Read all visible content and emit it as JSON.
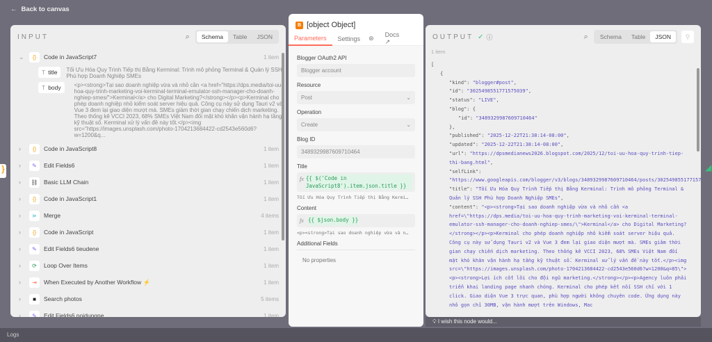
{
  "back_label": "Back to canvas",
  "input": {
    "title": "INPUT",
    "views": [
      "Schema",
      "Table",
      "JSON"
    ],
    "active_view": "Schema",
    "expanded": {
      "name": "Code in JavaScript7",
      "count": "1 item",
      "fields": [
        {
          "key": "title",
          "value": "Tối Ưu Hóa Quy Trình Tiếp thị Bằng Kerminal: Trình mô phỏng Terminal & Quản lý SSH Phù hợp Doanh Nghiệp SMEs"
        },
        {
          "key": "body",
          "value": "<p><strong>Tại sao doanh nghiệp vừa và nhỏ cần <a href=\"https://dps.media/toi-uu-hoa-quy-trinh-marketing-voi-kerminal-terminal-emulator-ssh-manager-cho-doanh-nghiep-smes/\">Kerminal</a> cho Digital Marketing?</strong></p><p>Kerminal cho phép doanh nghiệp nhỏ kiểm soát server hiệu quả. Công cụ này sử dụng Tauri v2 và Vue 3 đem lại giao diện mượt mà. SMEs giảm thời gian chạy chiến dịch marketing. Theo thống kê VCCI 2023, 68% SMEs Việt Nam đối mặt khó khăn vận hành hạ tầng kỹ thuật số. Kerminal xử lý vấn đề này tốt.</p><img src=\"https://images.unsplash.com/photo-1704213684422-cd2543e560d6?w=1200&q..."
        }
      ]
    },
    "nodes": [
      {
        "name": "Code in JavaScript8",
        "count": "1 item",
        "icon": "code-icon",
        "glyph": "{}",
        "color": "#f5a623"
      },
      {
        "name": "Edit Fields6",
        "count": "1 item",
        "icon": "pencil-icon",
        "glyph": "✎",
        "color": "#7b6cf6"
      },
      {
        "name": "Basic LLM Chain",
        "count": "1 item",
        "icon": "link-icon",
        "glyph": "⛓",
        "color": "#555"
      },
      {
        "name": "Code in JavaScript1",
        "count": "1 item",
        "icon": "code-icon",
        "glyph": "{}",
        "color": "#f5a623"
      },
      {
        "name": "Merge",
        "count": "4 items",
        "icon": "merge-icon",
        "glyph": "⋗",
        "color": "#3bb3c3"
      },
      {
        "name": "Code in JavaScript",
        "count": "1 item",
        "icon": "code-icon",
        "glyph": "{}",
        "color": "#f5a623"
      },
      {
        "name": "Edit Fields6 tieudene",
        "count": "1 item",
        "icon": "pencil-icon",
        "glyph": "✎",
        "color": "#7b6cf6"
      },
      {
        "name": "Loop Over Items",
        "count": "1 item",
        "icon": "loop-icon",
        "glyph": "⟳",
        "color": "#2c9a5a"
      },
      {
        "name": "When Executed by Another Workflow",
        "count": "1 item",
        "icon": "trigger-icon",
        "glyph": "⇥",
        "color": "#ff6d5a",
        "badge": "⚡"
      },
      {
        "name": "Search photos",
        "count": "5 items",
        "icon": "camera-icon",
        "glyph": "■",
        "color": "#222"
      },
      {
        "name": "Edit Fields6 noidungne",
        "count": "1 item",
        "icon": "pencil-icon",
        "glyph": "✎",
        "color": "#7b6cf6"
      }
    ]
  },
  "node": {
    "title": {
      "label": "Title",
      "expr": "{{ $('Code in JavaScript8').item.json.title }}",
      "preview": "Tối Ưu Hóa Quy Trình Tiếp thị Bằng Kermi…"
    },
    "logo": "B",
    "tabs": {
      "parameters": "Parameters",
      "settings": "Settings",
      "docs": "Docs"
    },
    "credential": {
      "label": "Blogger OAuth2 API",
      "value": "Blogger account"
    },
    "resource": {
      "label": "Resource",
      "value": "Post"
    },
    "operation": {
      "label": "Operation",
      "value": "Create"
    },
    "blog_id": {
      "label": "Blog ID",
      "value": "3489329987609710464"
    },
    "content": {
      "label": "Content",
      "expr": "{{ $json.body }}",
      "preview": "<p><strong>Tại sao doanh nghiệp vừa và n…"
    },
    "additional": {
      "label": "Additional Fields",
      "empty": "No properties"
    }
  },
  "output": {
    "title": "OUTPUT",
    "views": [
      "Schema",
      "Table",
      "JSON"
    ],
    "active_view": "JSON",
    "count": "1 item",
    "lines": [
      {
        "i": 0,
        "t": "["
      },
      {
        "i": 1,
        "t": "{"
      },
      {
        "i": 2,
        "k": "\"kind\": ",
        "v": "\"blogger#post\"",
        "e": ","
      },
      {
        "i": 2,
        "k": "\"id\": ",
        "v": "\"3025498551771575039\"",
        "e": ","
      },
      {
        "i": 2,
        "k": "\"status\": ",
        "v": "\"LIVE\"",
        "e": ","
      },
      {
        "i": 2,
        "k": "\"blog\": ",
        "t": "{"
      },
      {
        "i": 3,
        "k": "\"id\": ",
        "v": "\"3489329987609710464\""
      },
      {
        "i": 2,
        "t": "},"
      },
      {
        "i": 2,
        "k": "\"published\": ",
        "v": "\"2025-12-22T21:38:14-08:00\"",
        "e": ","
      },
      {
        "i": 2,
        "k": "\"updated\": ",
        "v": "\"2025-12-22T21:38:14-08:00\"",
        "e": ","
      },
      {
        "i": 2,
        "k": "\"url\": ",
        "v": "\"https://dpsmedianews2026.blogspot.com/2025/12/toi-uu-hoa-quy-trinh-tiep-thi-bang.html\"",
        "e": ","
      },
      {
        "i": 2,
        "k": "\"selfLink\": ",
        "v": "\"https://www.googleapis.com/blogger/v3/blogs/3489329987609710464/posts/3025498551771575039\"",
        "e": ","
      },
      {
        "i": 2,
        "k": "\"title\": ",
        "v": "\"Tối Ưu Hóa Quy Trình Tiếp thị Bằng Kerminal: Trình mô phỏng Terminal & Quản lý SSH Phù hợp Doanh Nghiệp SMEs\"",
        "e": ","
      },
      {
        "i": 2,
        "k": "\"content\": ",
        "v": "\"<p><strong>Tại sao doanh nghiệp vừa và nhỏ cần <a href=\\\"https://dps.media/toi-uu-hoa-quy-trinh-marketing-voi-kerminal-terminal-emulator-ssh-manager-cho-doanh-nghiep-smes/\\\">Kerminal</a> cho Digital Marketing?</strong></p><p>Kerminal cho phép doanh nghiệp nhỏ kiểm soát server hiệu quả. Công cụ này sử dụng Tauri v2 và Vue 3 đem lại giao diện mượt mà. SMEs giảm thời gian chạy chiến dịch marketing. Theo thống kê VCCI 2023, 68% SMEs Việt Nam đối mặt khó khăn vận hành hạ tầng kỹ thuật số. Kerminal xử lý vấn đề này tốt.</p><img src=\\\"https://images.unsplash.com/photo-1704213684422-cd2543e560d6?w=1200&q=85\\\"><p><strong>Lợi ích cốt lõi cho đội ngũ marketing.</strong></p><p>Agency luôn phải triển khai landing page nhanh chóng. Kerminal cho phép kết nối SSH chỉ với 1 click. Giao diện Vue 3 trực quan, phù hợp người không chuyên code. Ứng dụng này nhỏ gọn chỉ 30MB, vận hành mượt trên Windows, Mac"
      }
    ]
  },
  "feedback": "I wish this node would...",
  "logs": "Logs",
  "colors": {
    "accent": "#ff6d5a",
    "string": "#5a4fbf",
    "expression": "#2c9a5a",
    "success": "#3cbf7a"
  }
}
